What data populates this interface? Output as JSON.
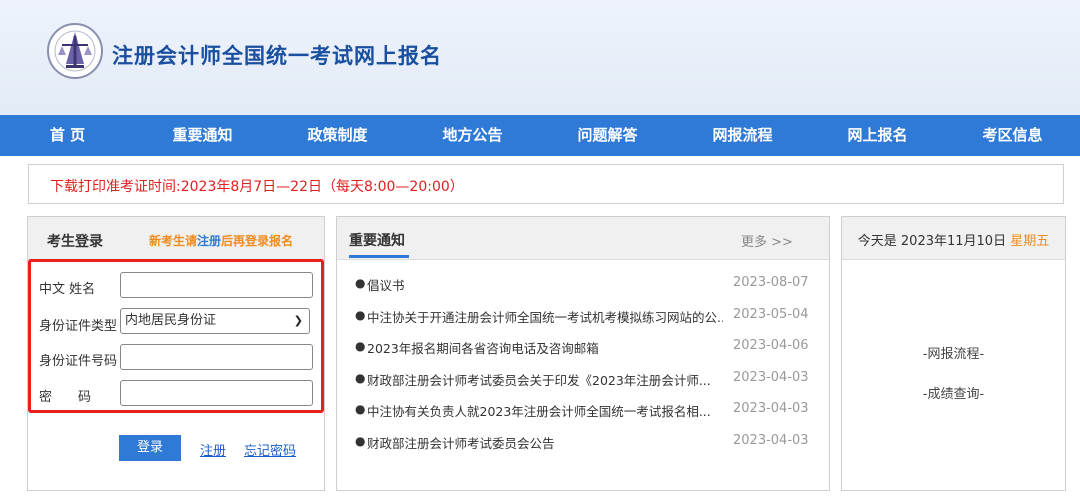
{
  "header": {
    "title": "注册会计师全国统一考试网上报名"
  },
  "nav": [
    "首 页",
    "重要通知",
    "政策制度",
    "地方公告",
    "问题解答",
    "网报流程",
    "网上报名",
    "考区信息"
  ],
  "notice": "下载打印准考证时间:2023年8月7日—22日（每天8:00—20:00）",
  "login": {
    "title": "考生登录",
    "tip_prefix": "新考生请",
    "tip_register": "注册",
    "tip_suffix": "后再登录报名",
    "fields": {
      "name_label": "中文 姓名",
      "id_type_label": "身份证件类型",
      "id_type_value": "内地居民身份证",
      "id_number_label": "身份证件号码",
      "password_label": "密　　码"
    },
    "login_button": "登录",
    "register_link": "注册",
    "forgot_link": "忘记密码"
  },
  "news": {
    "title": "重要通知",
    "more": "更多 >>",
    "items": [
      {
        "title": "倡议书",
        "date": "2023-08-07"
      },
      {
        "title": "中注协关于开通注册会计师全国统一考试机考模拟练习网站的公...",
        "date": "2023-05-04"
      },
      {
        "title": "2023年报名期间各省咨询电话及咨询邮箱",
        "date": "2023-04-06"
      },
      {
        "title": "财政部注册会计师考试委员会关于印发《2023年注册会计师...",
        "date": "2023-04-03"
      },
      {
        "title": "中注协有关负责人就2023年注册会计师全国统一考试报名相...",
        "date": "2023-04-03"
      },
      {
        "title": "财政部注册会计师考试委员会公告",
        "date": "2023-04-03"
      }
    ]
  },
  "side": {
    "date_prefix": "今天是 2023年11月10日",
    "weekday": "星期五",
    "link1": "-网报流程-",
    "link2": "-成绩查询-"
  },
  "colors": {
    "brand": "#2f7ad6",
    "alert": "#e02020",
    "accent": "#f08c1e"
  }
}
